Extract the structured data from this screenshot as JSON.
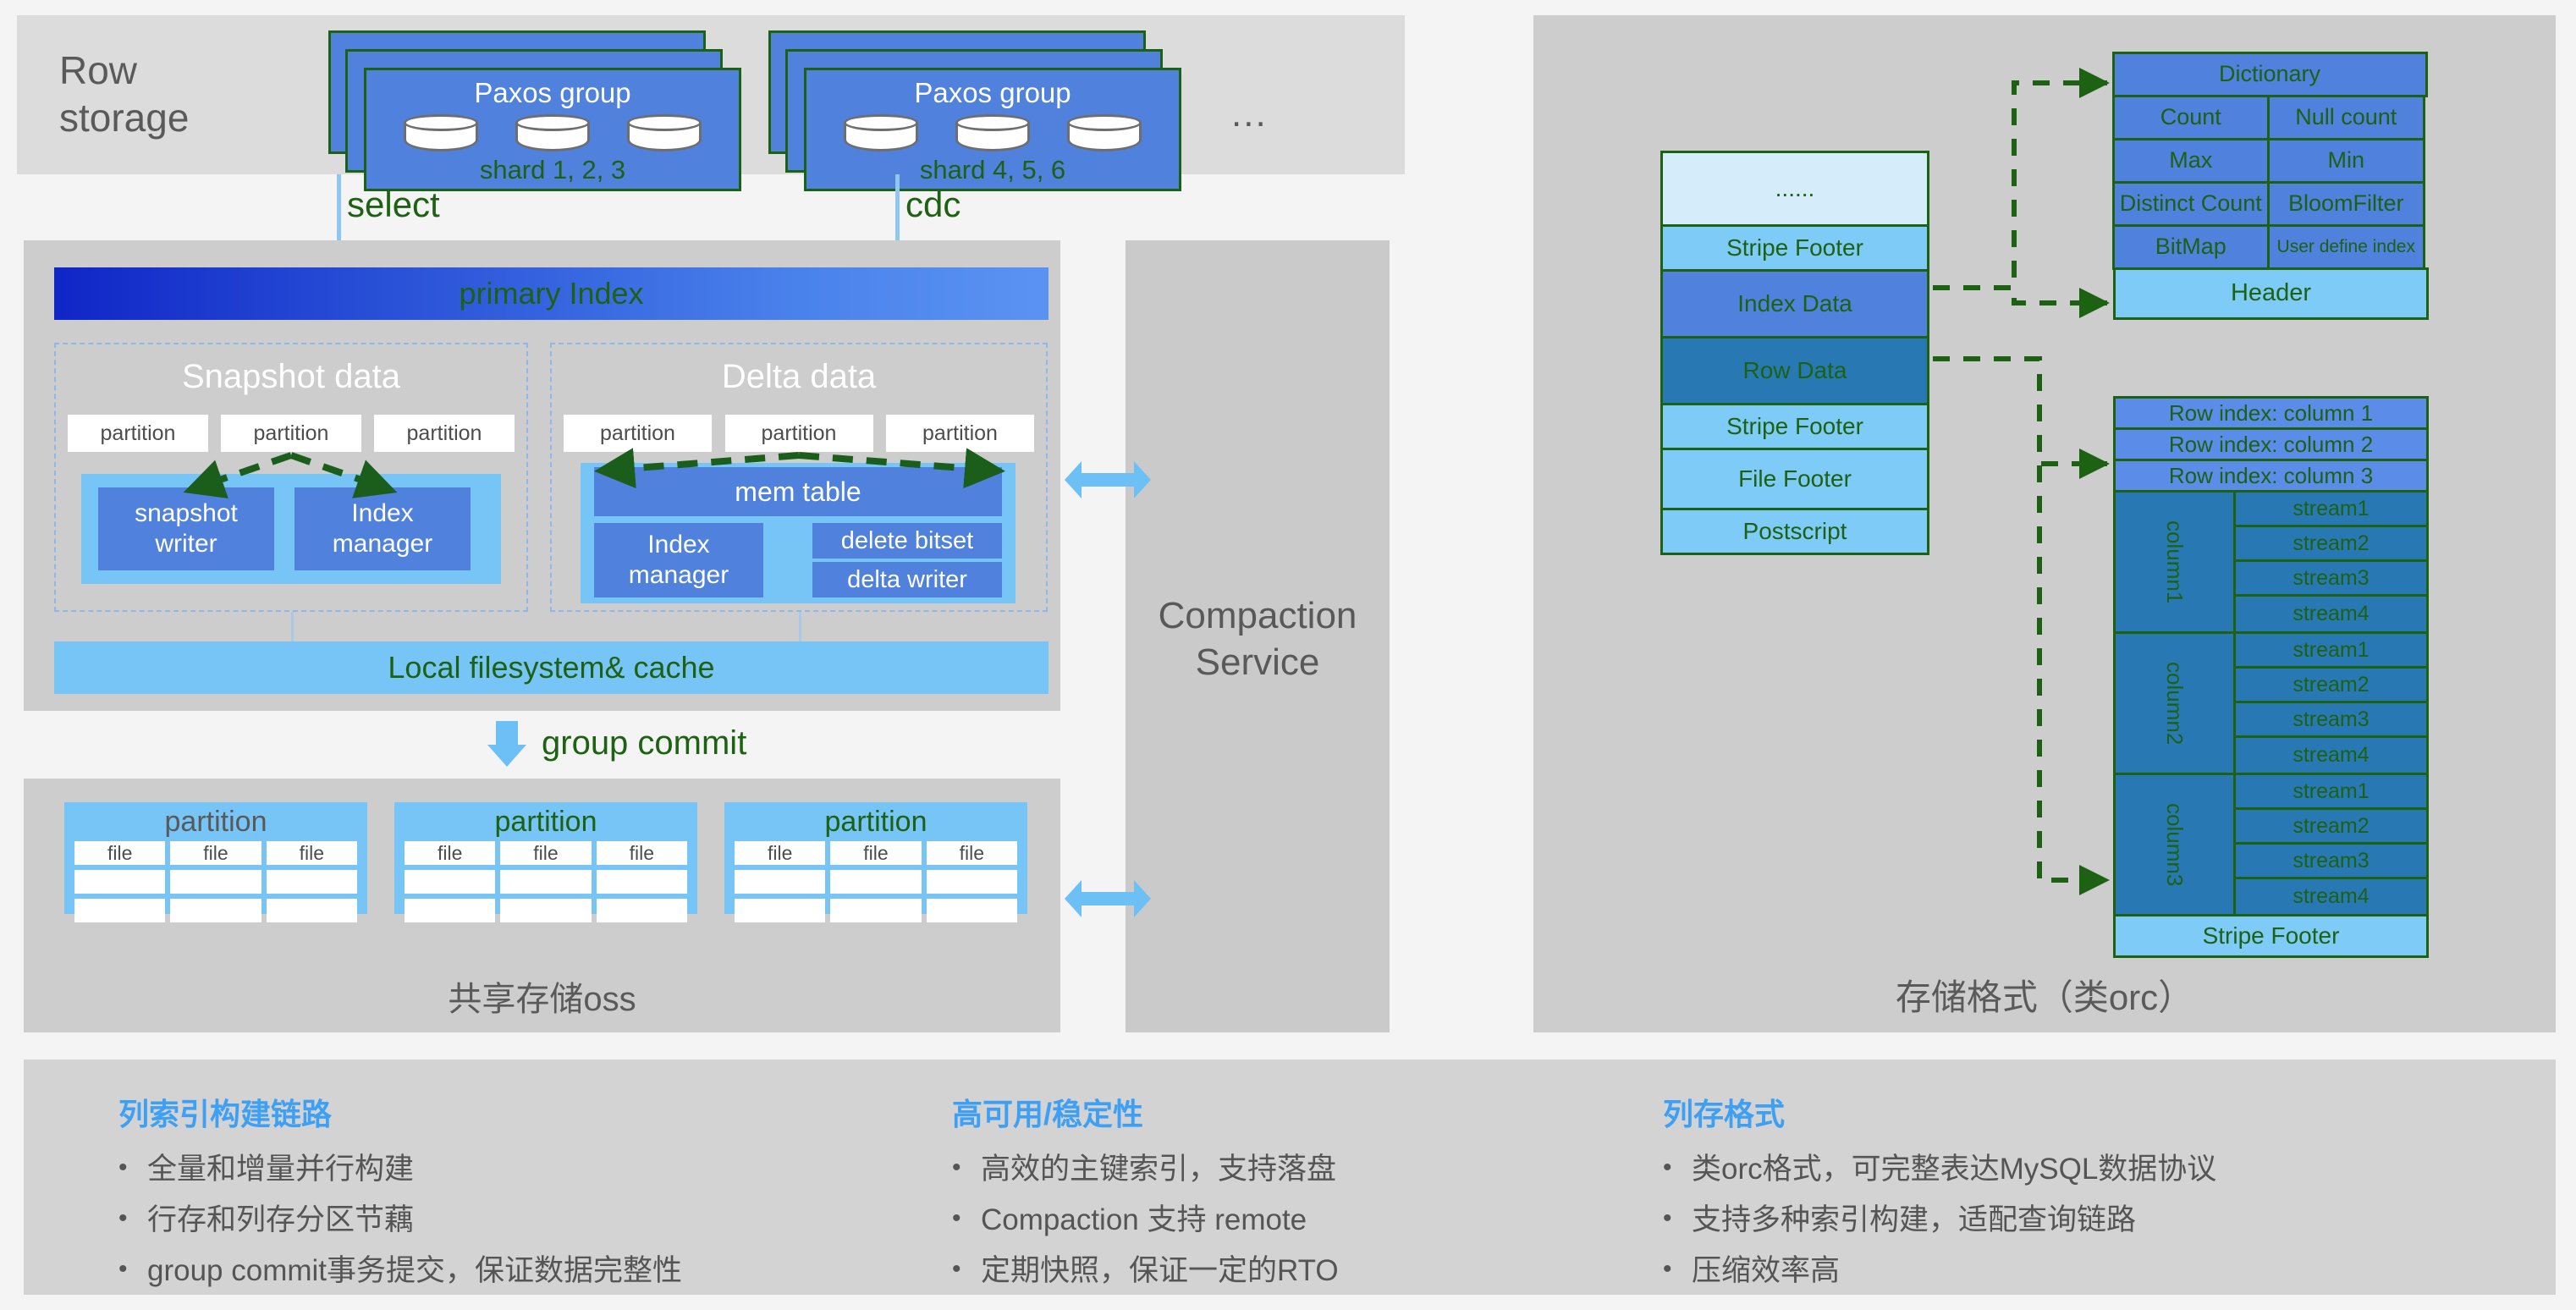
{
  "row_storage": {
    "label": "Row\nstorage",
    "label_line1": "Row",
    "label_line2": "storage",
    "groups": [
      {
        "title": "Paxos group",
        "shards": "shard 1, 2, 3"
      },
      {
        "title": "Paxos group",
        "shards": "shard 4, 5, 6"
      }
    ],
    "ellipsis": "..."
  },
  "flows": {
    "select": "select",
    "cdc": "cdc",
    "group_commit": "group commit"
  },
  "engine": {
    "primary_index": "primary Index",
    "snapshot": {
      "title": "Snapshot data",
      "partitions": [
        "partition",
        "partition",
        "partition"
      ],
      "boxes": [
        "snapshot writer",
        "Index manager"
      ],
      "box1_line1": "snapshot",
      "box1_line2": "writer",
      "box2_line1": "Index",
      "box2_line2": "manager"
    },
    "delta": {
      "title": "Delta data",
      "partitions": [
        "partition",
        "partition",
        "partition"
      ],
      "mem_table": "mem table",
      "index_manager_line1": "Index",
      "index_manager_line2": "manager",
      "delete_bitset": "delete bitset",
      "delta_writer": "delta writer"
    },
    "local_fs": "Local filesystem& cache"
  },
  "oss": {
    "partitions": [
      {
        "title": "partition",
        "files": [
          "file",
          "file",
          "file"
        ]
      },
      {
        "title": "partition",
        "files": [
          "file",
          "file",
          "file"
        ]
      },
      {
        "title": "partition",
        "files": [
          "file",
          "file",
          "file"
        ]
      }
    ],
    "label": "共享存储oss"
  },
  "compaction": {
    "line1": "Compaction",
    "line2": "Service"
  },
  "orc": {
    "label": "存储格式（类orc）",
    "stripe_blocks": [
      {
        "text": "......",
        "style": "pale",
        "height": 74
      },
      {
        "text": "Stripe Footer",
        "style": "lite",
        "height": 48
      },
      {
        "text": "Index Data",
        "style": "mid",
        "height": 70
      },
      {
        "text": "Row Data",
        "style": "deep",
        "height": 70
      },
      {
        "text": "Stripe Footer",
        "style": "lite",
        "height": 48
      },
      {
        "text": "File Footer",
        "style": "lite",
        "height": 62
      },
      {
        "text": "Postscript",
        "style": "lite",
        "height": 48
      }
    ],
    "meta_table": {
      "dictionary": "Dictionary",
      "rows": [
        [
          "Count",
          "Null count"
        ],
        [
          "Max",
          "Min"
        ],
        [
          "Distinct Count",
          "BloomFilter"
        ],
        [
          "BitMap",
          "User define index"
        ]
      ],
      "header": "Header"
    },
    "stream_table": {
      "row_indexes": [
        "Row index: column 1",
        "Row index: column 2",
        "Row index: column 3"
      ],
      "columns": [
        {
          "name": "column1",
          "streams": [
            "stream1",
            "stream2",
            "stream3",
            "stream4"
          ]
        },
        {
          "name": "column2",
          "streams": [
            "stream1",
            "stream2",
            "stream3",
            "stream4"
          ]
        },
        {
          "name": "column3",
          "streams": [
            "stream1",
            "stream2",
            "stream3",
            "stream4"
          ]
        }
      ],
      "stripe_footer": "Stripe Footer"
    }
  },
  "notes": [
    {
      "title": "列索引构建链路",
      "items": [
        "全量和增量并行构建",
        "行存和列存分区节藕",
        "group commit事务提交，保证数据完整性"
      ]
    },
    {
      "title": "高可用/稳定性",
      "items": [
        "高效的主键索引，支持落盘",
        "Compaction 支持 remote",
        "定期快照，保证一定的RTO"
      ]
    },
    {
      "title": "列存格式",
      "items": [
        "类orc格式，可完整表达MySQL数据协议",
        "支持多种索引构建，适配查询链路",
        "压缩效率高"
      ]
    }
  ],
  "colors": {
    "green": "#1d6112",
    "blue_mid": "#4f81dd",
    "blue_light": "#77c4f7",
    "blue_deep": "#2879b3",
    "accent": "#3da0f5",
    "panel_gray": "#cdcdcd"
  }
}
